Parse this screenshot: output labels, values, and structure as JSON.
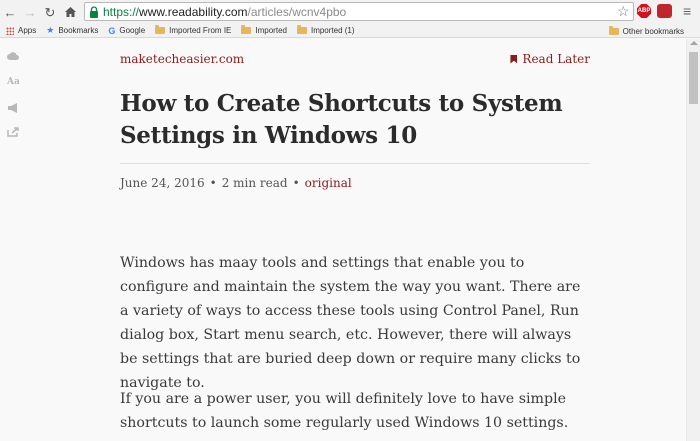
{
  "browser": {
    "url_scheme": "https://",
    "url_host": "www.readability.com",
    "url_path": "/articles/wcnv4pbo",
    "ext_abp_label": "ABP"
  },
  "bookmarks": [
    {
      "label": "Apps",
      "icon": "apps-icon"
    },
    {
      "label": "Bookmarks",
      "icon": "star-icon"
    },
    {
      "label": "Google",
      "icon": "google-icon"
    },
    {
      "label": "Imported From IE",
      "icon": "folder-icon"
    },
    {
      "label": "Imported",
      "icon": "folder-icon"
    },
    {
      "label": "Imported (1)",
      "icon": "folder-icon"
    }
  ],
  "bookmarks_other": "Other bookmarks",
  "article": {
    "site": "maketecheasier.com",
    "read_later": "Read Later",
    "title": "How to Create Shortcuts to System Settings in Windows 10",
    "date": "June 24, 2016",
    "separator": "•",
    "read_time": "2 min read",
    "original_link": "original",
    "paragraphs": [
      "Windows has maay tools and settings that enable you to configure and maintain the system the way you want. There are a variety of ways to access these tools using Control Panel, Run dialog box, Start menu search, etc. However, there will always be settings that are buried deep down or require many clicks to navigate to.",
      "If you are a power user, you will definitely love to have simple shortcuts to launch some regularly used Windows 10 settings."
    ]
  },
  "colors": {
    "accent": "#8a1c1c",
    "text": "#3a3a3a",
    "title": "#2b2b2b"
  }
}
